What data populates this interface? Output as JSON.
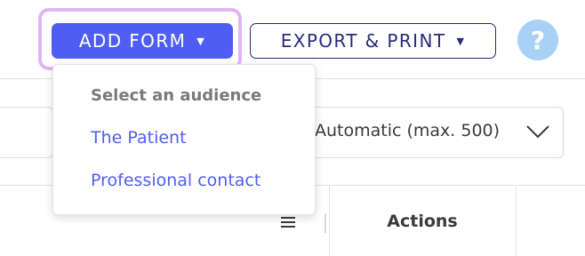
{
  "toolbar": {
    "add_form_label": "ADD FORM",
    "export_print_label": "EXPORT & PRINT",
    "help_label": "?"
  },
  "dropdown": {
    "heading": "Select an audience",
    "items": [
      {
        "label": "The Patient"
      },
      {
        "label": "Professional contact"
      }
    ]
  },
  "filters": {
    "limit_select_value": "Automatic (max. 500)"
  },
  "table": {
    "actions_header": "Actions"
  },
  "colors": {
    "accent": "#4f5ef2",
    "export_text": "#2b2a7a",
    "highlight": "#e2b5f2",
    "help_bg": "#a9d1f6"
  }
}
